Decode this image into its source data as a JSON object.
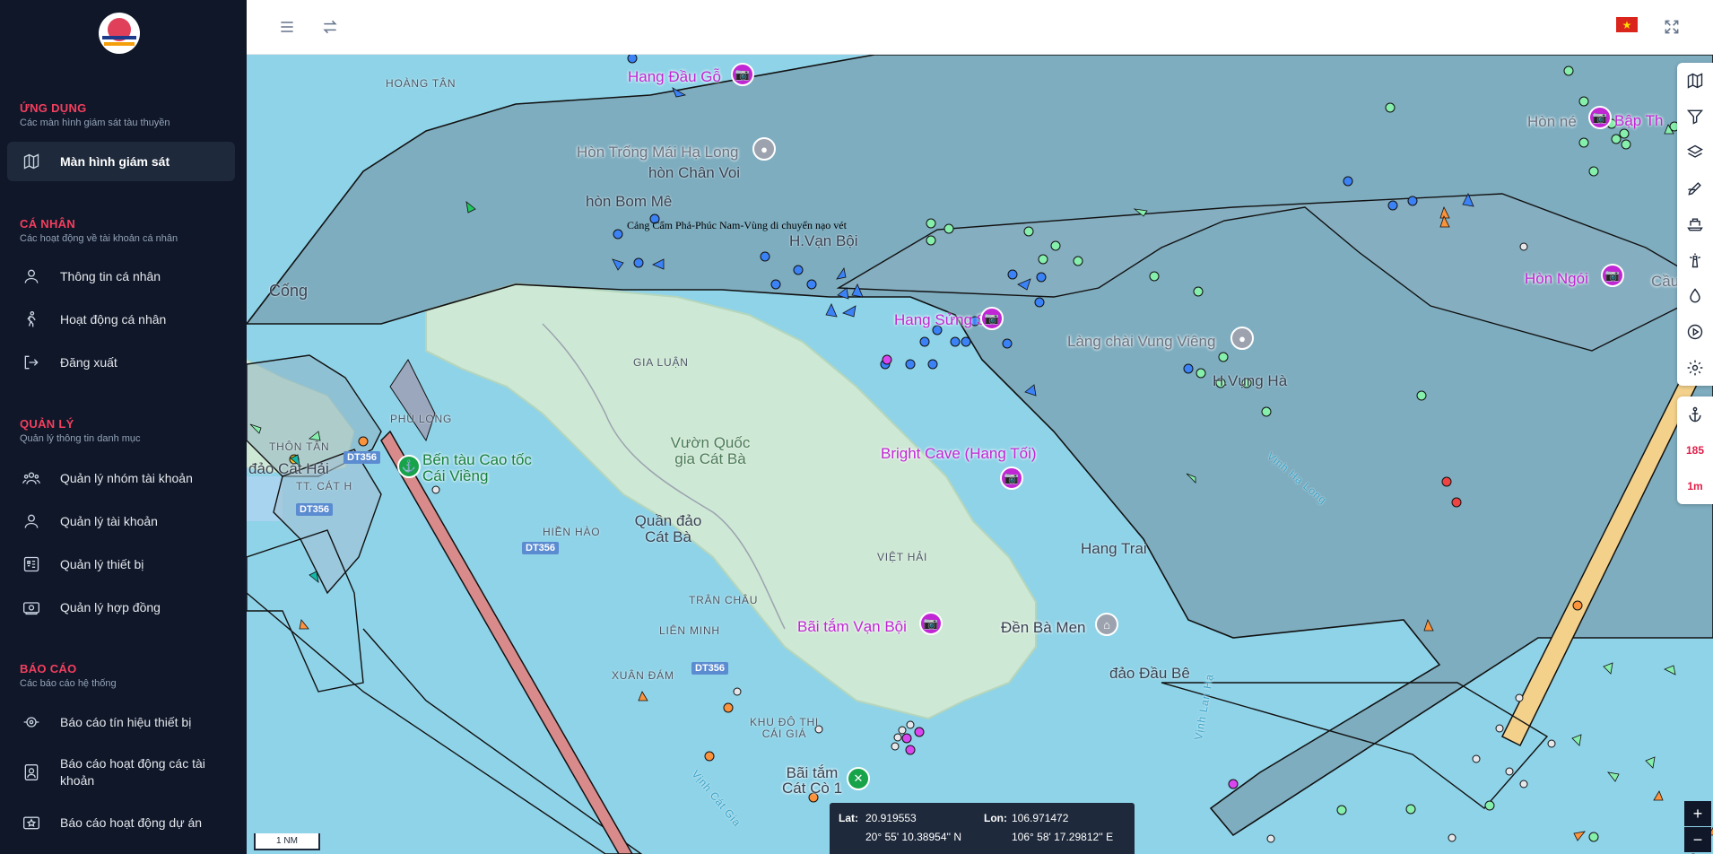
{
  "sidebar": {
    "sections": [
      {
        "title": "ỨNG DỤNG",
        "subtitle": "Các màn hình giám sát tàu thuyền",
        "items": [
          {
            "label": "Màn hình giám sát",
            "icon": "map-icon",
            "active": true
          }
        ]
      },
      {
        "title": "CÁ NHÂN",
        "subtitle": "Các hoạt động về tài khoản cá nhân",
        "items": [
          {
            "label": "Thông tin cá nhân",
            "icon": "user-icon"
          },
          {
            "label": "Hoạt động cá nhân",
            "icon": "activity-icon"
          },
          {
            "label": "Đăng xuất",
            "icon": "logout-icon"
          }
        ]
      },
      {
        "title": "QUẢN LÝ",
        "subtitle": "Quản lý thông tin danh mục",
        "items": [
          {
            "label": "Quản lý nhóm tài khoản",
            "icon": "users-icon"
          },
          {
            "label": "Quản lý tài khoản",
            "icon": "user-icon"
          },
          {
            "label": "Quản lý thiết bị",
            "icon": "device-icon"
          },
          {
            "label": "Quản lý hợp đồng",
            "icon": "contract-icon"
          }
        ]
      },
      {
        "title": "BÁO CÁO",
        "subtitle": "Các báo cáo hệ thống",
        "items": [
          {
            "label": "Báo cáo tín hiệu thiết bị",
            "icon": "signal-icon"
          },
          {
            "label": "Báo cáo hoạt động các tài khoản",
            "icon": "report-icon"
          },
          {
            "label": "Báo cáo hoạt động dự án",
            "icon": "project-icon"
          }
        ]
      }
    ]
  },
  "topbar": {
    "language_flag": "vietnam-flag-icon"
  },
  "map": {
    "zone_label": "Cảng Cẩm Phả-Phúc Nam-Vùng di chuyển nạo vét",
    "pois": [
      {
        "name": "Hang Đầu Gỗ"
      },
      {
        "name": "Hòn Trống Mái Hạ Long"
      },
      {
        "name": "Hang Sửng Sốt"
      },
      {
        "name": "Làng chài Vung Viêng"
      },
      {
        "name": "Bright Cave (Hang Tối)"
      },
      {
        "name": "Bãi tắm Vạn Bội"
      },
      {
        "name": "Đền Bà Men"
      },
      {
        "name": "Hòn Ngói"
      },
      {
        "name": "Bến tàu Cao tốc Cái Viềng"
      },
      {
        "name": "Bãi tắm Cát Cò 1"
      },
      {
        "name": "Hòn né"
      },
      {
        "name": "Bập Th"
      },
      {
        "name": "Cầu"
      }
    ],
    "places": {
      "hoang_tan": "HOÀNG TÂN",
      "hon_chan_voi": "hòn Chân Voi",
      "hon_bom_me": "hòn Bom Mê",
      "h_van_boi": "H.Vạn Bội",
      "cong": "Cống",
      "gia_luan": "GIA LUẬN",
      "phu_long": "PHÙ LONG",
      "thon_tan": "THÔN TÂN",
      "dao_cat_hai": "đảo Cát Hải",
      "tt_cat_hai": "TT. CÁT H",
      "vuon_quoc_gia": "Vườn Quốc gia Cát Bà",
      "quan_dao_cat_ba": "Quần đảo Cát Bà",
      "hien_hao": "HIỀN HÀO",
      "viet_hai": "VIỆT HẢI",
      "tran_chau": "TRÂN CHÂU",
      "lien_minh": "LIÊN MINH",
      "xuan_dam": "XUÂN ĐÁM",
      "khu_do_thi": "KHU ĐÔ THỊ CÁI GIÁ",
      "h_vung_ha": "H.Vụng Hà",
      "vinh_ha_long": "Vịnh Hạ Long",
      "hang_trai": "Hang Trai",
      "dao_dau_be": "đảo Đầu Bê",
      "vinh_lan_ha": "Vịnh Lan Hạ",
      "vinh_cat_gia": "Vịnh Cát Gia"
    },
    "roads": [
      "DT356",
      "DT356",
      "DT356",
      "DT356"
    ],
    "right_tools": [
      "map-layers-icon",
      "filter-icon",
      "layers-icon",
      "draw-icon",
      "ship-icon",
      "lighthouse-icon",
      "drop-icon",
      "play-icon",
      "settings-icon"
    ],
    "anchor_tool": {
      "icon": "anchor-icon",
      "count": "185",
      "time": "1m"
    },
    "zoom_in": "+",
    "zoom_out": "−",
    "scale": "1 NM",
    "coords": {
      "lat_label": "Lat:",
      "lat_dec": "20.919553",
      "lat_dms": "20° 55' 10.38954'' N",
      "lon_label": "Lon:",
      "lon_dec": "106.971472",
      "lon_dms": "106° 58' 17.29812'' E"
    }
  }
}
